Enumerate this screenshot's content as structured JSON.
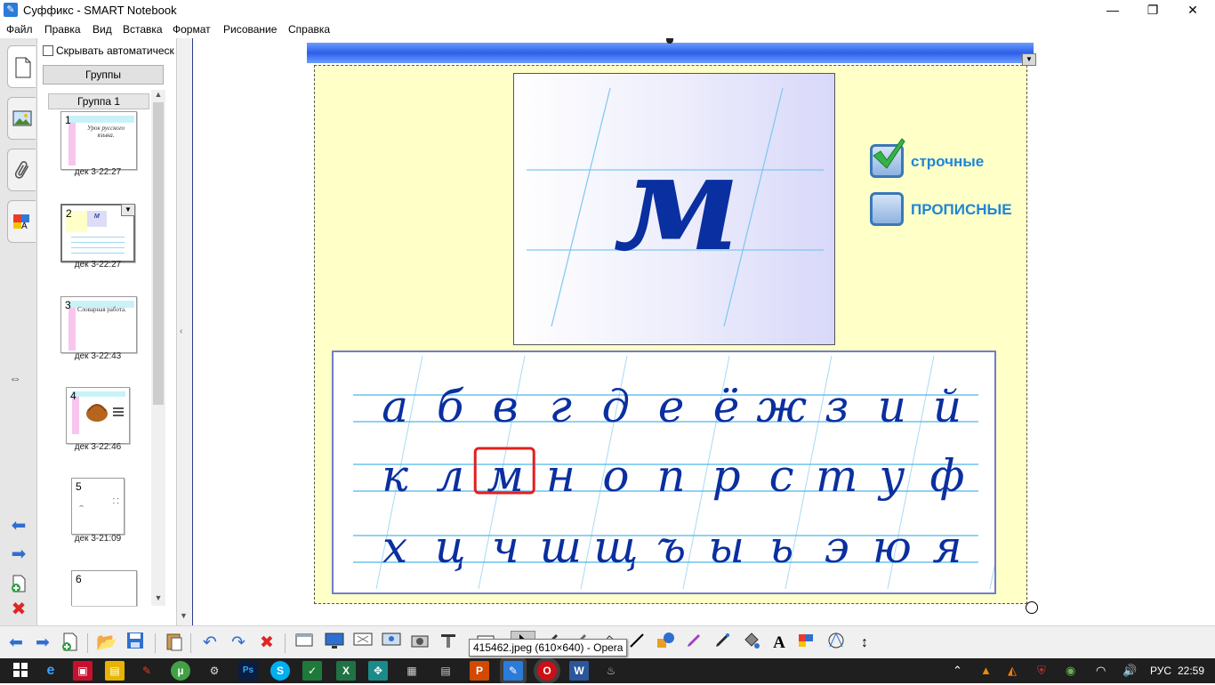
{
  "window": {
    "title": "Суффикс - SMART Notebook",
    "minimize": "—",
    "maximize": "❐",
    "close": "✕"
  },
  "menu": [
    "Файл",
    "Правка",
    "Вид",
    "Вставка",
    "Формат",
    "Рисование",
    "Справка"
  ],
  "sorter": {
    "autohide_label": "Скрывать автоматическ",
    "groups_button": "Группы",
    "group_name": "Группа 1",
    "pages": [
      {
        "num": "1",
        "date": "дек 3-22:27",
        "text": "Урок русского языка."
      },
      {
        "num": "2",
        "date": "дек 3-22:27",
        "text": ""
      },
      {
        "num": "3",
        "date": "дек 3-22:43",
        "text": "Словарная работа."
      },
      {
        "num": "4",
        "date": "дек 3-22:46",
        "text": ""
      },
      {
        "num": "5",
        "date": "дек 3-21:09",
        "text": ""
      },
      {
        "num": "6",
        "date": "",
        "text": ""
      }
    ]
  },
  "slide": {
    "big_letter": "м",
    "options": [
      {
        "label": "строчные",
        "checked": true
      },
      {
        "label": "ПРОПИСНЫЕ",
        "checked": false
      }
    ],
    "alphabet_rows": [
      [
        "а",
        "б",
        "в",
        "г",
        "д",
        "е",
        "ё",
        "ж",
        "з",
        "и",
        "й"
      ],
      [
        "к",
        "л",
        "м",
        "н",
        "о",
        "п",
        "р",
        "с",
        "т",
        "у",
        "ф"
      ],
      [
        "х",
        "ц",
        "ч",
        "ш",
        "щ",
        "ъ",
        "ы",
        "ь",
        "э",
        "ю",
        "я"
      ]
    ],
    "highlighted_letter": "м"
  },
  "tooltip": "415462.jpeg (610×640) - Opera",
  "taskbar": {
    "lang": "РУС",
    "time": "22:59"
  },
  "colors": {
    "page_bg": "#ffffc8",
    "script_ink": "#0a2fa0",
    "ruling": "#4db6ea",
    "highlight": "#e02020",
    "option_text": "#1f86d6"
  }
}
